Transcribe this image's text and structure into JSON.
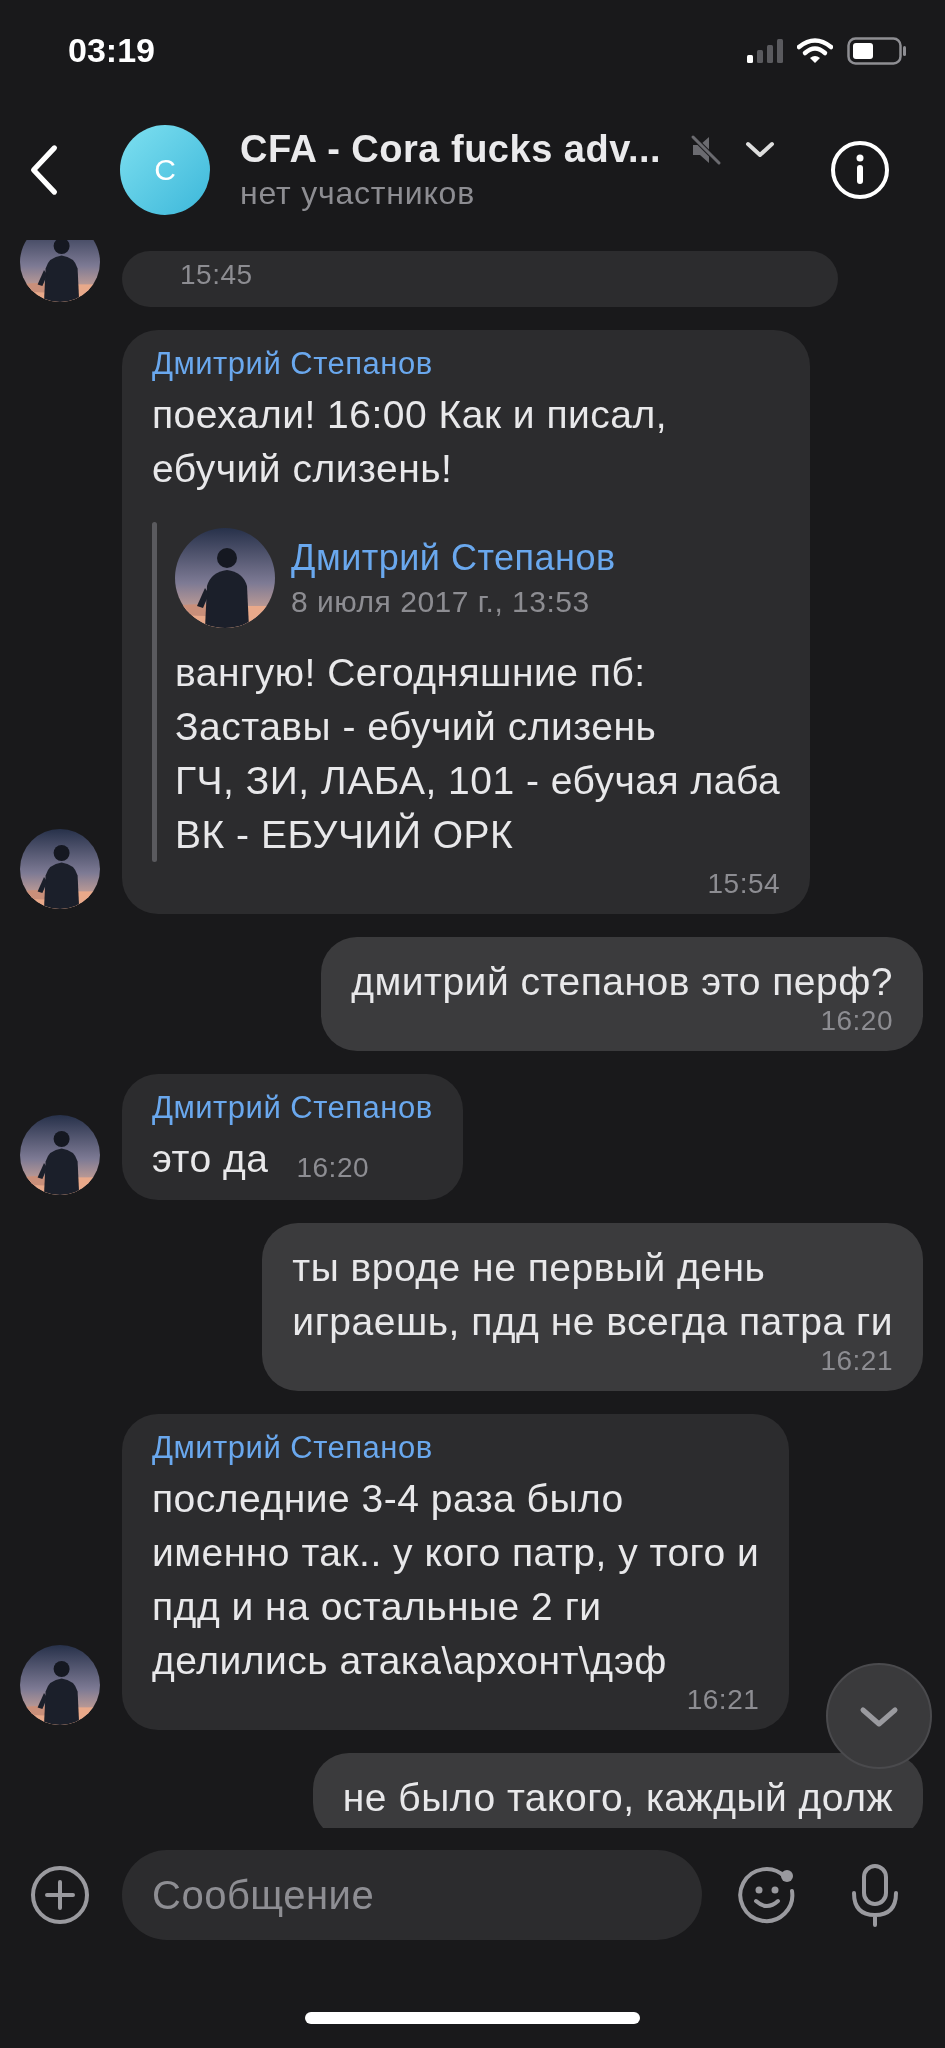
{
  "status_bar": {
    "time": "03:19"
  },
  "header": {
    "avatar_letter": "C",
    "title": "CFA - Cora fucks adv...",
    "subtitle": "нет участников",
    "muted": true
  },
  "messages": [
    {
      "kind": "incoming",
      "time": "15:45"
    },
    {
      "kind": "incoming",
      "sender": "Дмитрий Степанов",
      "text": "поехали! 16:00 Как и писал,\nебучий слизень!",
      "quote": {
        "sender": "Дмитрий Степанов",
        "date": "8 июля 2017 г., 13:53",
        "text": "вангую! Сегодняшние пб:\nЗаставы - ебучий слизень\nГЧ, ЗИ, ЛАБА, 101 - ебучая лаба\nВК - ЕБУЧИЙ ОРК"
      },
      "time": "15:54"
    },
    {
      "kind": "outgoing",
      "text": "дмитрий степанов это перф?",
      "time": "16:20"
    },
    {
      "kind": "incoming",
      "sender": "Дмитрий Степанов",
      "text": "это да",
      "time": "16:20"
    },
    {
      "kind": "outgoing",
      "text": "ты вроде не первый день\nиграешь, пдд не всегда патра ги",
      "time": "16:21"
    },
    {
      "kind": "incoming",
      "sender": "Дмитрий Степанов",
      "text": "последние 3-4 раза было\nименно так.. у кого патр, у того и\nпдд и на остальные 2 ги\nделились атака\\архонт\\дэф",
      "time": "16:21"
    },
    {
      "kind": "outgoing",
      "text": "не было такого, каждый долж"
    }
  ],
  "composer": {
    "placeholder": "Сообщение"
  }
}
